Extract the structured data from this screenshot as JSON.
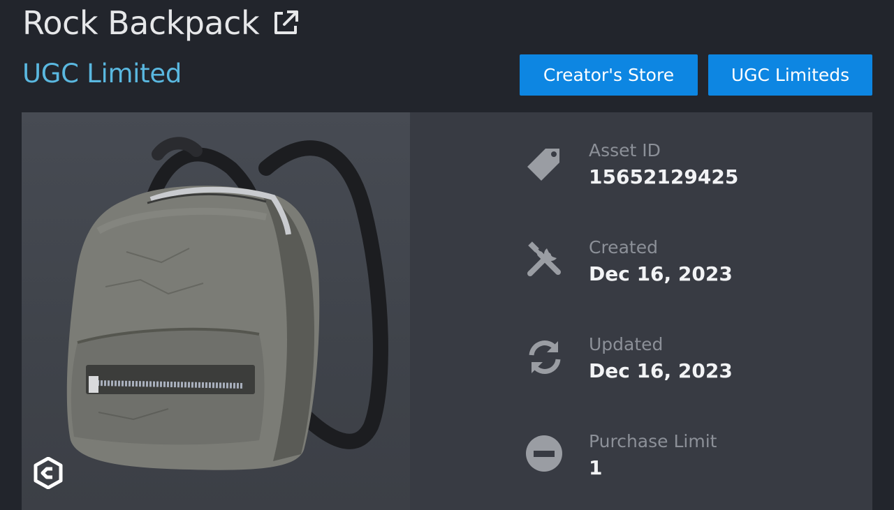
{
  "item": {
    "title": "Rock Backpack",
    "type": "UGC Limited"
  },
  "buttons": {
    "creators_store": "Creator's Store",
    "ugc_limiteds": "UGC Limiteds"
  },
  "details": [
    {
      "label": "Asset ID",
      "value": "15652129425",
      "icon": "tag-icon"
    },
    {
      "label": "Created",
      "value": "Dec 16, 2023",
      "icon": "tools-icon"
    },
    {
      "label": "Updated",
      "value": "Dec 16, 2023",
      "icon": "sync-icon"
    },
    {
      "label": "Purchase Limit",
      "value": "1",
      "icon": "minus-circle-icon"
    }
  ],
  "colors": {
    "background": "#22252c",
    "panel": "#383b43",
    "accent_link": "#5ab8e0",
    "button": "#0d86e2"
  }
}
